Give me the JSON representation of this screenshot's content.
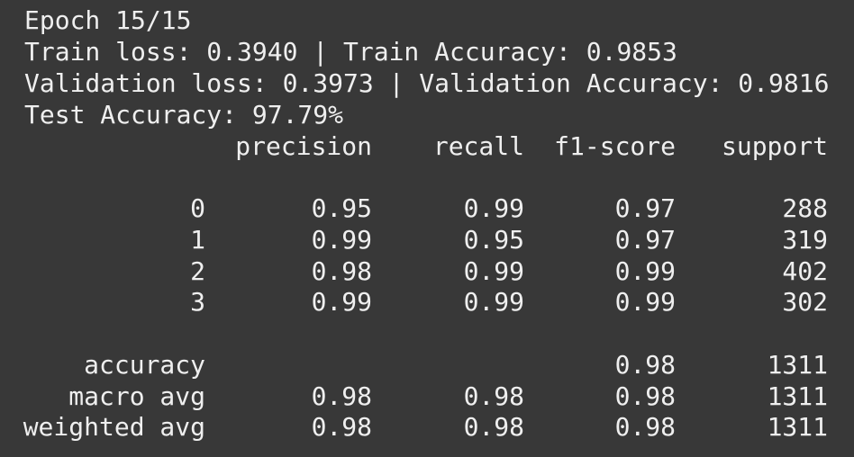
{
  "terminal": {
    "epoch_line": "Epoch 15/15",
    "train_line": "Train loss: 0.3940 | Train Accuracy: 0.9853",
    "val_line": "Validation loss: 0.3973 | Validation Accuracy: 0.9816",
    "test_line": "Test Accuracy: 97.79%"
  },
  "report": {
    "headers": {
      "precision": "precision",
      "recall": "recall",
      "f1": "f1-score",
      "support": "support"
    },
    "classes": [
      {
        "label": "0",
        "precision": "0.95",
        "recall": "0.99",
        "f1": "0.97",
        "support": "288"
      },
      {
        "label": "1",
        "precision": "0.99",
        "recall": "0.95",
        "f1": "0.97",
        "support": "319"
      },
      {
        "label": "2",
        "precision": "0.98",
        "recall": "0.99",
        "f1": "0.99",
        "support": "402"
      },
      {
        "label": "3",
        "precision": "0.99",
        "recall": "0.99",
        "f1": "0.99",
        "support": "302"
      }
    ],
    "accuracy": {
      "label": "accuracy",
      "f1": "0.98",
      "support": "1311"
    },
    "macro": {
      "label": "macro avg",
      "precision": "0.98",
      "recall": "0.98",
      "f1": "0.98",
      "support": "1311"
    },
    "weighted": {
      "label": "weighted avg",
      "precision": "0.98",
      "recall": "0.98",
      "f1": "0.98",
      "support": "1311"
    }
  }
}
